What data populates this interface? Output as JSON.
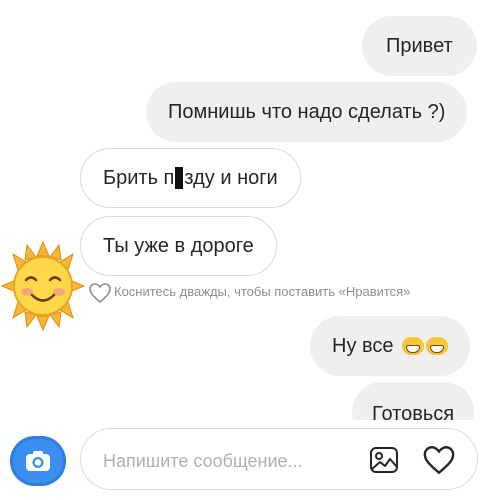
{
  "messages": [
    {
      "id": "m1",
      "dir": "out",
      "text": "Привет"
    },
    {
      "id": "m2",
      "dir": "out",
      "text": "Помнишь что надо сделать ?)"
    },
    {
      "id": "m3",
      "dir": "in",
      "text_before": "Брить п",
      "text_after": "зду и ноги"
    },
    {
      "id": "m4",
      "dir": "in",
      "text": "Ты уже в дороге"
    },
    {
      "id": "m5",
      "dir": "out",
      "text": "Ну все"
    },
    {
      "id": "m6",
      "dir": "out",
      "text": "Готовься"
    }
  ],
  "like_hint": "Коснитесь дважды, чтобы поставить «Нравится»",
  "composer": {
    "placeholder": "Напишите сообщение..."
  },
  "colors": {
    "accent": "#3a8ff0",
    "outgoing_bubble": "#efefef",
    "incoming_border": "#dbdbdb",
    "hint_text": "#8e8e8e"
  },
  "icons": [
    "camera-icon",
    "gallery-icon",
    "heart-icon",
    "sun-sticker-icon",
    "grin-emoji-icon"
  ]
}
